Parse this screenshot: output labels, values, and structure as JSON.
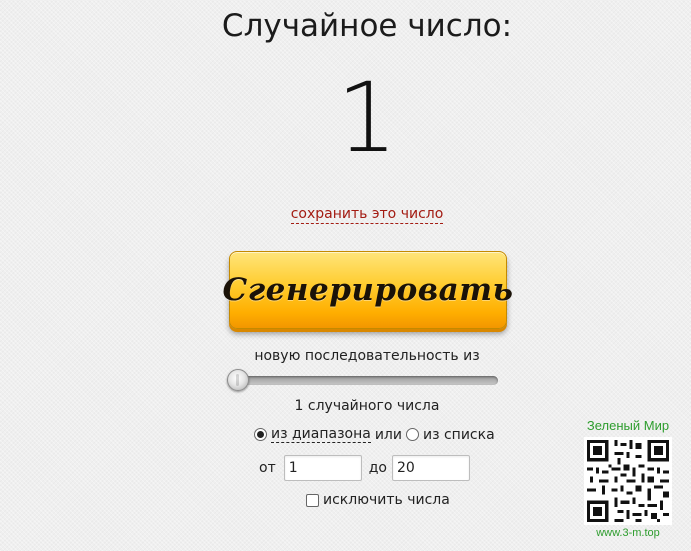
{
  "title": "Случайное число:",
  "result": "1",
  "save_link": "сохранить это число",
  "generate_button": "Сгенерировать",
  "sequence_label": "новую последовательность из",
  "slider": {
    "value": 1,
    "min": 1
  },
  "count_label": "1 случайного числа",
  "source": {
    "range_label": "из диапазона",
    "or_label": "или",
    "list_label": "из списка",
    "selected": "range"
  },
  "range": {
    "from_label": "от",
    "from_value": "1",
    "to_label": "до",
    "to_value": "20"
  },
  "exclude_label": "исключить числа",
  "exclude_checked": false,
  "brand": {
    "name": "Зеленый Мир",
    "url": "www.3-m.top",
    "color": "#2e9d2e"
  },
  "colors": {
    "button_gradient_top": "#ffe57a",
    "button_gradient_bottom": "#f29600",
    "link": "#a31b12"
  }
}
